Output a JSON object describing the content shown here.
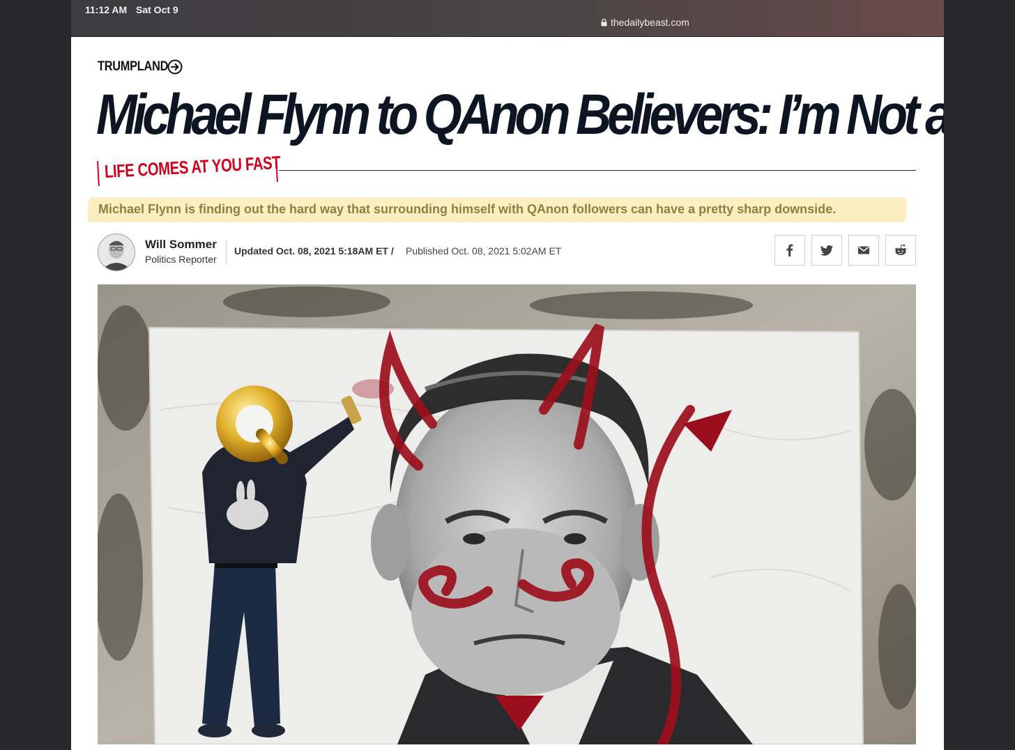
{
  "status_bar": {
    "time": "11:12 AM",
    "date": "Sat Oct 9",
    "url": "thedailybeast.com"
  },
  "article": {
    "section": "TRUMPLAND",
    "headline": "Michael Flynn to QAnon Believers: I’m Not a Satanist!",
    "rubric": "LIFE COMES AT YOU FAST",
    "dek": "Michael Flynn is finding out the hard way that surrounding himself with QAnon followers can have a pretty sharp downside.",
    "author": {
      "name": "Will Sommer",
      "role": "Politics Reporter"
    },
    "updated": "Updated Oct. 08, 2021 5:18AM ET /",
    "published": "Published Oct. 08, 2021 5:02AM ET",
    "share": [
      "facebook-icon",
      "twitter-icon",
      "mail-icon",
      "reddit-icon"
    ]
  },
  "colors": {
    "accent_red": "#d0021b",
    "headline": "#0e1522",
    "dek_highlight": "#fbefc2",
    "dek_text": "#8a8240"
  }
}
